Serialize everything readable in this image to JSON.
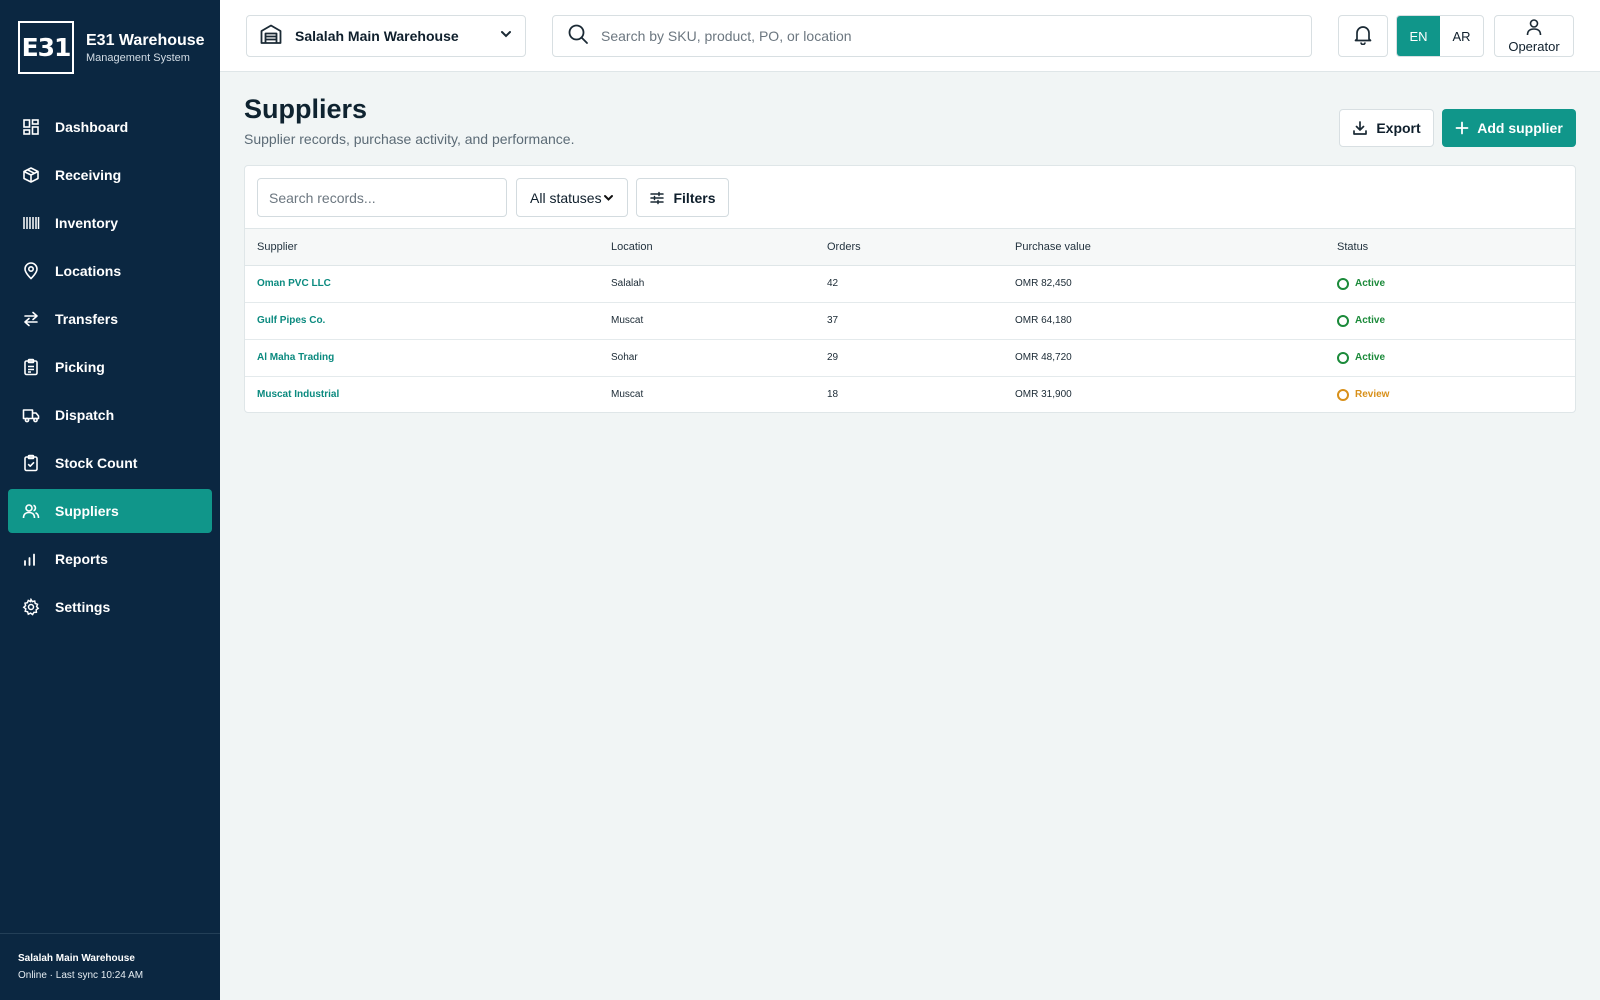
{
  "brand": {
    "logo_text": "E31",
    "title": "E31 Warehouse",
    "subtitle": "Management System"
  },
  "nav": [
    {
      "label": "Dashboard",
      "icon": "dashboard-icon"
    },
    {
      "label": "Receiving",
      "icon": "package-icon"
    },
    {
      "label": "Inventory",
      "icon": "barcode-icon"
    },
    {
      "label": "Locations",
      "icon": "map-pin-icon"
    },
    {
      "label": "Transfers",
      "icon": "transfer-arrows-icon"
    },
    {
      "label": "Picking",
      "icon": "clipboard-list-icon"
    },
    {
      "label": "Dispatch",
      "icon": "truck-icon"
    },
    {
      "label": "Stock Count",
      "icon": "clipboard-check-icon"
    },
    {
      "label": "Suppliers",
      "icon": "users-icon",
      "active": true
    },
    {
      "label": "Reports",
      "icon": "bar-chart-icon"
    },
    {
      "label": "Settings",
      "icon": "gear-icon"
    }
  ],
  "footer": {
    "warehouse": "Salalah Main Warehouse",
    "status": "Online · Last sync 10:24 AM"
  },
  "topbar": {
    "warehouse_selector": "Salalah Main Warehouse",
    "search_placeholder": "Search by SKU, product, PO, or location",
    "lang_en": "EN",
    "lang_ar": "AR",
    "user_label": "Operator"
  },
  "page": {
    "title": "Suppliers",
    "subtitle": "Supplier records, purchase activity, and performance.",
    "export_label": "Export",
    "add_label": "Add supplier"
  },
  "toolbar": {
    "search_placeholder": "Search records...",
    "status_filter": "All statuses",
    "filters_label": "Filters"
  },
  "table": {
    "columns": [
      "Supplier",
      "Location",
      "Orders",
      "Purchase value",
      "Status"
    ],
    "rows": [
      {
        "supplier": "Oman PVC LLC",
        "location": "Salalah",
        "orders": "42",
        "value": "OMR 82,450",
        "status": "Active"
      },
      {
        "supplier": "Gulf Pipes Co.",
        "location": "Muscat",
        "orders": "37",
        "value": "OMR 64,180",
        "status": "Active"
      },
      {
        "supplier": "Al Maha Trading",
        "location": "Sohar",
        "orders": "29",
        "value": "OMR 48,720",
        "status": "Active"
      },
      {
        "supplier": "Muscat Industrial",
        "location": "Muscat",
        "orders": "18",
        "value": "OMR 31,900",
        "status": "Review"
      }
    ]
  },
  "colors": {
    "sidebar": "#0b2741",
    "accent": "#10968a",
    "active_status": "#1b8a3a",
    "review_status": "#d8901a"
  }
}
